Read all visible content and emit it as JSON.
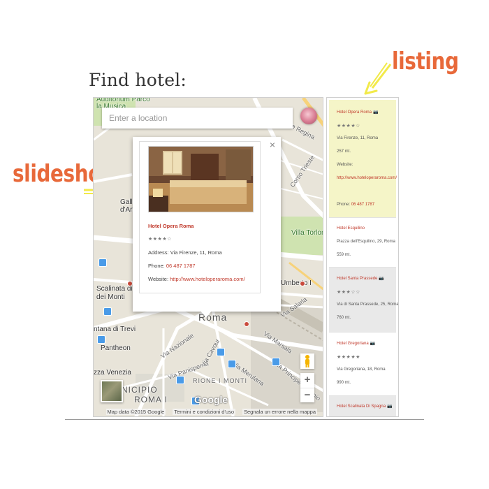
{
  "page": {
    "title": "Find hotel:"
  },
  "annotations": {
    "listing": "listing",
    "slideshow": "slideshow",
    "color": "#e8693a",
    "arrow_color": "#f2ea4a"
  },
  "map": {
    "search_placeholder": "Enter a location",
    "labels": {
      "parco_musica": "Auditorium Parco",
      "la_musica": "la Musica",
      "corso_trieste": "Corso Trieste",
      "villa_torlonia": "Villa Torlon",
      "umberto": "Umberto I",
      "scalinata": "Scalinata di",
      "dei_monti": "dei Monti",
      "fontana_trevi": "ntana di Trevi",
      "pantheon": "Pantheon",
      "piazza_venezia": "zza Venezia",
      "rione_monti": "RIONE I MONTI",
      "municipio": "NICIPIO",
      "roma_i": "ROMA I",
      "roma": "Roma",
      "galleria": "Galle",
      "d_arte": "d'Art",
      "via_nazionale": "Via Nazionale",
      "via_panisperna": "Via Panisperna",
      "via_cavour": "Via Cavour",
      "via_marsala": "Via Marsala",
      "via_merulana": "Via Merulana",
      "via_principe": "Via Principe Eugenio",
      "viale_regina": "Viale Regina",
      "via_salaria": "Via Salaria"
    },
    "info_window": {
      "close": "×",
      "name": "Hotel Opera Roma",
      "stars": "★★★★☆",
      "address_label": "Address: ",
      "address": "Via Firenze, 11, Roma",
      "phone_label": "Phone: ",
      "phone": "06 487 1787",
      "website_label": "Website: ",
      "website": "http://www.hoteloperaroma.com/"
    },
    "zoom_in": "+",
    "zoom_out": "−",
    "logo": "Google",
    "footer": {
      "data": "Map data ©2015 Google",
      "terms": "Termini e condizioni d'uso",
      "report": "Segnala un errore nella mappa"
    }
  },
  "listing": {
    "items": [
      {
        "name": "Hotel Opera Roma",
        "stars": "★★★★☆",
        "address": "Via Firenze, 11, Roma",
        "distance": "257 mt.",
        "website_label": "Website:",
        "website": "http://www.hoteloperaroma.com/",
        "phone_label": "Phone:",
        "phone": "06 487 1787"
      },
      {
        "name": "Hotel Esquilino",
        "address": "Piazza dell'Esquilino, 29, Roma",
        "distance": "559 mt."
      },
      {
        "name": "Hotel Santa Prassede",
        "stars": "★★★☆☆",
        "address": "Via di Santa Prassede, 25, Roma",
        "distance": "760 mt."
      },
      {
        "name": "Hotel Gregoriana",
        "stars": "★★★★★",
        "address": "Via Gregoriana, 18, Roma",
        "distance": "990 mt."
      },
      {
        "name": "Hotel Scalinata Di Spagna"
      }
    ]
  }
}
